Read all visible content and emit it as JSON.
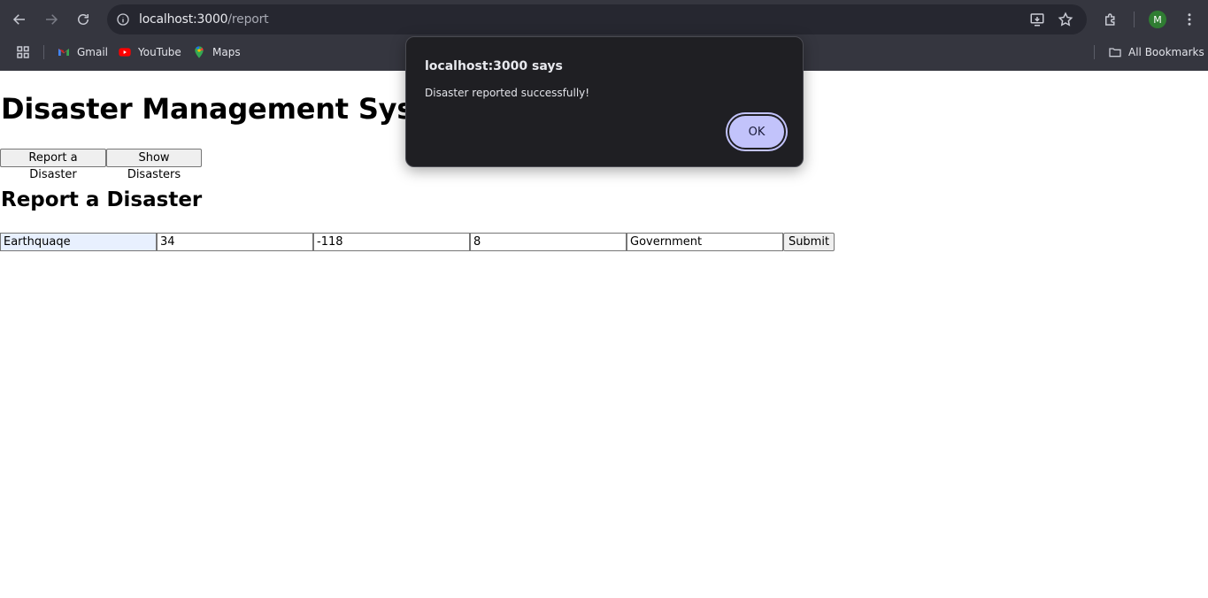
{
  "browser": {
    "url_host": "localhost:3000",
    "url_path": "/report",
    "avatar_letter": "M",
    "bookmarks": [
      {
        "label": "Gmail",
        "icon": "gmail-icon"
      },
      {
        "label": "YouTube",
        "icon": "youtube-icon"
      },
      {
        "label": "Maps",
        "icon": "maps-icon"
      }
    ],
    "all_bookmarks_label": "All Bookmarks"
  },
  "page": {
    "title": "Disaster Management System",
    "nav": {
      "report_label": "Report a Disaster",
      "show_label": "Show Disasters"
    },
    "section_title": "Report a Disaster",
    "form": {
      "type_value": "Earthquaqe",
      "latitude_value": "34",
      "longitude_value": "-118",
      "severity_value": "8",
      "reporter_value": "Government",
      "submit_label": "Submit"
    }
  },
  "dialog": {
    "title": "localhost:3000 says",
    "message": "Disaster reported successfully!",
    "ok_label": "OK"
  },
  "colors": {
    "chrome_bg": "#35363f",
    "omnibox_bg": "#262730",
    "dialog_bg": "#1f1f23",
    "ok_button": "#c2c3fb",
    "autofill_bg": "#e8f0fe"
  }
}
